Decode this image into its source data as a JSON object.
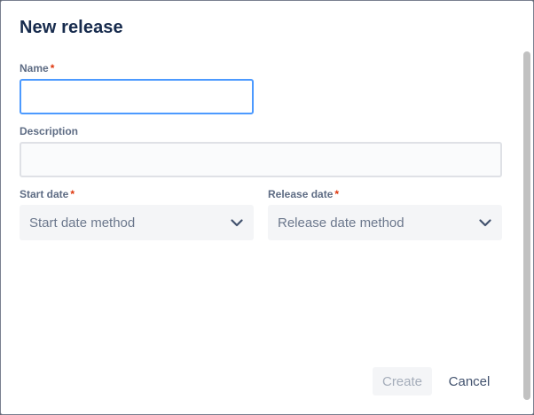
{
  "dialog": {
    "title": "New release",
    "fields": {
      "name": {
        "label": "Name",
        "required_mark": "*",
        "value": "",
        "placeholder": ""
      },
      "description": {
        "label": "Description",
        "value": "",
        "placeholder": ""
      },
      "start_date": {
        "label": "Start date",
        "required_mark": "*",
        "selected": "Start date method",
        "icon": "chevron-down-icon"
      },
      "release_date": {
        "label": "Release date",
        "required_mark": "*",
        "selected": "Release date method",
        "icon": "chevron-down-icon"
      }
    },
    "buttons": {
      "create_label": "Create",
      "create_disabled": true,
      "cancel_label": "Cancel"
    }
  },
  "colors": {
    "focus_border": "#4c9aff",
    "required": "#de350b",
    "label": "#5e6c84",
    "title": "#172b4d"
  }
}
